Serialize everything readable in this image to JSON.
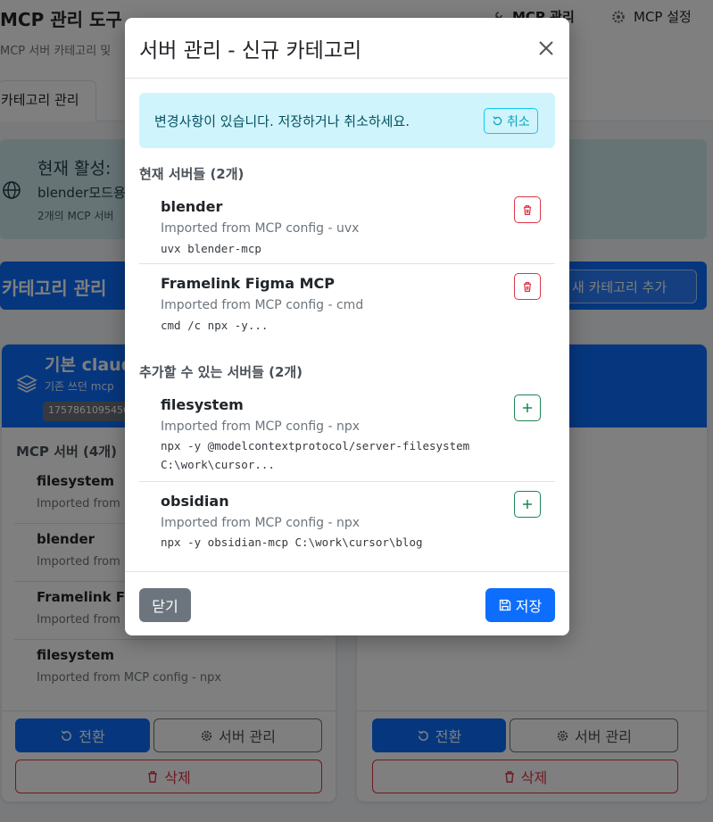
{
  "app": {
    "title": "MCP 관리 도구",
    "subtitle": "MCP 서버 카테고리 및",
    "nav": {
      "mcp_manage": "MCP 관리",
      "mcp_settings": "MCP 설정"
    }
  },
  "tabs": {
    "active": "카테고리 관리"
  },
  "active_category": {
    "title": "현재 활성:",
    "name": "blender모드용",
    "count_text": "2개의 MCP 서버"
  },
  "category_bar": {
    "title": "카테고리 관리",
    "add_button": "새 카테고리 추가"
  },
  "card_left": {
    "name": "기본 claud",
    "description": "기존 쓰던 mcp",
    "id": "1757861095450",
    "servers_title": "MCP 서버 (4개)",
    "servers": [
      {
        "name": "filesystem",
        "desc": "Imported from"
      },
      {
        "name": "blender",
        "desc": "Imported from"
      },
      {
        "name": "Framelink Fig",
        "desc": "Imported from"
      },
      {
        "name": "filesystem",
        "desc": "Imported from MCP config - npx"
      }
    ],
    "buttons": {
      "switch": "전환",
      "manage": "서버 관리",
      "delete": "삭제"
    }
  },
  "card_right": {
    "buttons": {
      "switch": "전환",
      "manage": "서버 관리",
      "delete": "삭제"
    }
  },
  "modal": {
    "title": "서버 관리 - 신규 카테고리",
    "alert": {
      "text": "변경사항이 있습니다. 저장하거나 취소하세요.",
      "undo_label": "취소"
    },
    "current_title": "현재 서버들 (2개)",
    "current_servers": [
      {
        "name": "blender",
        "desc": "Imported from MCP config - uvx",
        "cmd": "uvx blender-mcp"
      },
      {
        "name": "Framelink Figma MCP",
        "desc": "Imported from MCP config - cmd",
        "cmd": "cmd /c npx -y..."
      }
    ],
    "available_title": "추가할 수 있는 서버들 (2개)",
    "available_servers": [
      {
        "name": "filesystem",
        "desc": "Imported from MCP config - npx",
        "cmd_line1": "npx -y @modelcontextprotocol/server-filesystem",
        "cmd_line2": "C:\\work\\cursor..."
      },
      {
        "name": "obsidian",
        "desc": "Imported from MCP config - npx",
        "cmd_line1": "npx -y obsidian-mcp C:\\work\\cursor\\blog"
      }
    ],
    "footer": {
      "close_label": "닫기",
      "save_label": "저장"
    }
  },
  "colors": {
    "primary": "#0d6efd",
    "danger": "#dc3545",
    "success": "#198754",
    "info_bg": "#cff4fc",
    "secondary": "#6c757d"
  },
  "icons": [
    "gear-icon",
    "globe-icon",
    "layers-icon",
    "rotate-icon",
    "trash-icon",
    "plus-icon",
    "close-icon",
    "floppy-disk-icon"
  ]
}
